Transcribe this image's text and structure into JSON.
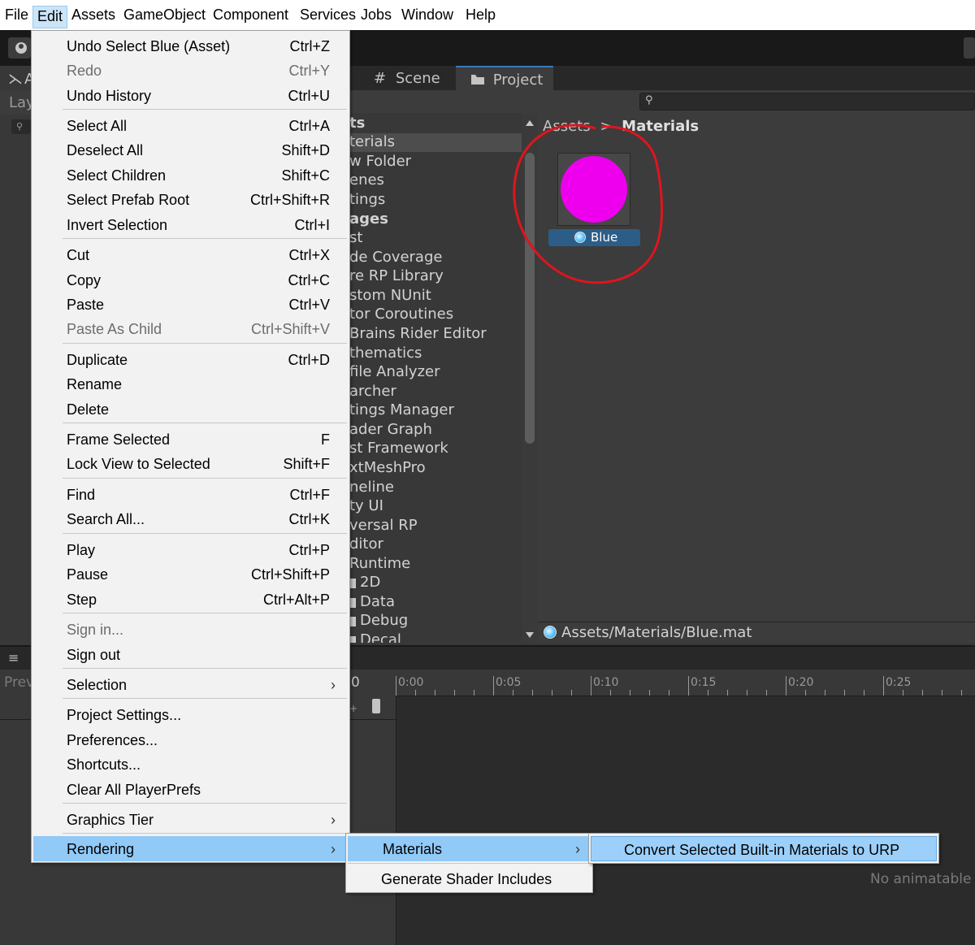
{
  "menubar": {
    "items": [
      "File",
      "Edit",
      "Assets",
      "GameObject",
      "Component",
      "Services",
      "Jobs",
      "Window",
      "Help"
    ]
  },
  "edit_menu": {
    "items": [
      {
        "label": "Undo Select Blue (Asset)",
        "shortcut": "Ctrl+Z"
      },
      {
        "label": "Redo",
        "shortcut": "Ctrl+Y",
        "disabled": true
      },
      {
        "label": "Undo History",
        "shortcut": "Ctrl+U"
      },
      {
        "label": "Select All",
        "shortcut": "Ctrl+A"
      },
      {
        "label": "Deselect All",
        "shortcut": "Shift+D"
      },
      {
        "label": "Select Children",
        "shortcut": "Shift+C"
      },
      {
        "label": "Select Prefab Root",
        "shortcut": "Ctrl+Shift+R"
      },
      {
        "label": "Invert Selection",
        "shortcut": "Ctrl+I"
      },
      {
        "label": "Cut",
        "shortcut": "Ctrl+X"
      },
      {
        "label": "Copy",
        "shortcut": "Ctrl+C"
      },
      {
        "label": "Paste",
        "shortcut": "Ctrl+V"
      },
      {
        "label": "Paste As Child",
        "shortcut": "Ctrl+Shift+V",
        "disabled": true
      },
      {
        "label": "Duplicate",
        "shortcut": "Ctrl+D"
      },
      {
        "label": "Rename",
        "shortcut": ""
      },
      {
        "label": "Delete",
        "shortcut": ""
      },
      {
        "label": "Frame Selected",
        "shortcut": "F"
      },
      {
        "label": "Lock View to Selected",
        "shortcut": "Shift+F"
      },
      {
        "label": "Find",
        "shortcut": "Ctrl+F"
      },
      {
        "label": "Search All...",
        "shortcut": "Ctrl+K"
      },
      {
        "label": "Play",
        "shortcut": "Ctrl+P"
      },
      {
        "label": "Pause",
        "shortcut": "Ctrl+Shift+P"
      },
      {
        "label": "Step",
        "shortcut": "Ctrl+Alt+P"
      },
      {
        "label": "Sign in...",
        "shortcut": "",
        "disabled": true
      },
      {
        "label": "Sign out",
        "shortcut": ""
      },
      {
        "label": "Selection",
        "shortcut": "",
        "submenu": true
      },
      {
        "label": "Project Settings...",
        "shortcut": ""
      },
      {
        "label": "Preferences...",
        "shortcut": ""
      },
      {
        "label": "Shortcuts...",
        "shortcut": ""
      },
      {
        "label": "Clear All PlayerPrefs",
        "shortcut": ""
      },
      {
        "label": "Graphics Tier",
        "shortcut": "",
        "submenu": true
      },
      {
        "label": "Rendering",
        "shortcut": "",
        "submenu": true,
        "highlighted": true
      }
    ]
  },
  "rendering_submenu": {
    "items": [
      {
        "label": "Materials",
        "submenu": true,
        "highlighted": true
      },
      {
        "label": "Generate Shader Includes"
      }
    ]
  },
  "materials_submenu": {
    "items": [
      {
        "label": "Convert Selected Built-in Materials to URP",
        "highlighted": true
      }
    ]
  },
  "editor": {
    "tabs": [
      "Scene",
      "Project"
    ],
    "active_tab": "Project",
    "tab_icons": [
      "hash-icon",
      "folder-icon"
    ],
    "left_fragments": [
      "A",
      "Lay"
    ],
    "bottom_left_fragment": "Prev",
    "frame_field": "0"
  },
  "project": {
    "breadcrumb": [
      "Assets",
      "Materials"
    ],
    "breadcrumb_sep": ">",
    "tree": [
      "ts",
      "terials",
      "w Folder",
      "enes",
      "tings",
      "ages",
      "st",
      "de Coverage",
      "re RP Library",
      "stom NUnit",
      "tor Coroutines",
      "Brains Rider Editor",
      "thematics",
      "file Analyzer",
      "archer",
      "tings Manager",
      "ader Graph",
      "st Framework",
      "xtMeshPro",
      "neline",
      "ty UI",
      "versal RP",
      "ditor",
      "Runtime",
      "2D",
      "Data",
      "Debug",
      "Decal"
    ],
    "asset_name": "Blue",
    "asset_color": "#ee00ee",
    "status_path": "Assets/Materials/Blue.mat"
  },
  "animation": {
    "ticks": [
      "0:00",
      "0:05",
      "0:10",
      "0:15",
      "0:20",
      "0:25"
    ],
    "empty_text": "No animatable"
  },
  "colors": {
    "highlight": "#91c9f7",
    "annotation": "#e0141e"
  }
}
